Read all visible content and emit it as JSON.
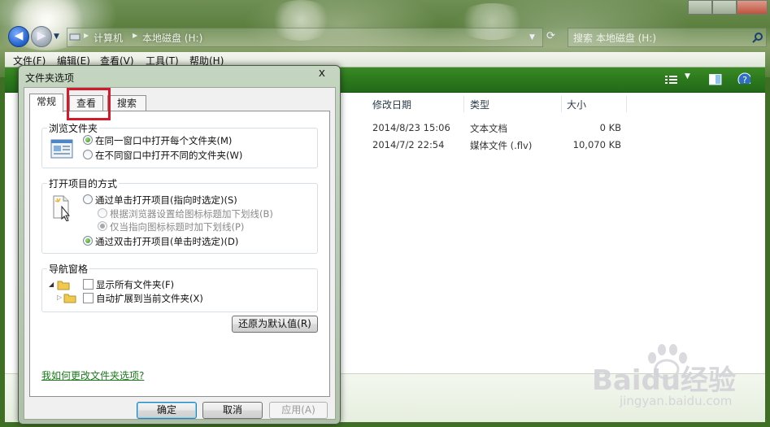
{
  "window": {
    "address": {
      "crumbs": [
        "计算机",
        "本地磁盘 (H:)"
      ]
    },
    "search_placeholder": "搜索 本地磁盘 (H:)",
    "menu": [
      "文件(F)",
      "编辑(E)",
      "查看(V)",
      "工具(T)",
      "帮助(H)"
    ]
  },
  "explorer": {
    "columns": [
      "修改日期",
      "类型",
      "大小"
    ],
    "files": [
      {
        "modified": "2014/8/23 15:06",
        "type": "文本文档",
        "size": "0 KB"
      },
      {
        "modified": "2014/7/2 22:54",
        "type": "媒体文件 (.flv)",
        "size": "10,070 KB"
      }
    ]
  },
  "watermark": {
    "brand": "Baidu经验",
    "url": "jingyan.baidu.com"
  },
  "dialog": {
    "title": "文件夹选项",
    "close_glyph": "x",
    "tabs": [
      "常规",
      "查看",
      "搜索"
    ],
    "active_tab": "常规",
    "browse_group": {
      "label": "浏览文件夹",
      "options": [
        {
          "label": "在同一窗口中打开每个文件夹(M)",
          "selected": true
        },
        {
          "label": "在不同窗口中打开不同的文件夹(W)",
          "selected": false
        }
      ]
    },
    "click_group": {
      "label": "打开项目的方式",
      "single_click": "通过单击打开项目(指向时选定)(S)",
      "sub_options": [
        {
          "label": "根据浏览器设置给图标标题加下划线(B)",
          "selected": false
        },
        {
          "label": "仅当指向图标标题时加下划线(P)",
          "selected": true
        }
      ],
      "double_click": "通过双击打开项目(单击时选定)(D)",
      "double_selected": true
    },
    "nav_group": {
      "label": "导航窗格",
      "checks": [
        {
          "label": "显示所有文件夹(F)",
          "checked": false
        },
        {
          "label": "自动扩展到当前文件夹(X)",
          "checked": false
        }
      ]
    },
    "restore_button": "还原为默认值(R)",
    "help_link": "我如何更改文件夹选项?",
    "buttons": {
      "ok": "确定",
      "cancel": "取消",
      "apply": "应用(A)"
    }
  },
  "colors": {
    "highlight": "#d21a2a",
    "toolbar": "#2d7a1d"
  }
}
